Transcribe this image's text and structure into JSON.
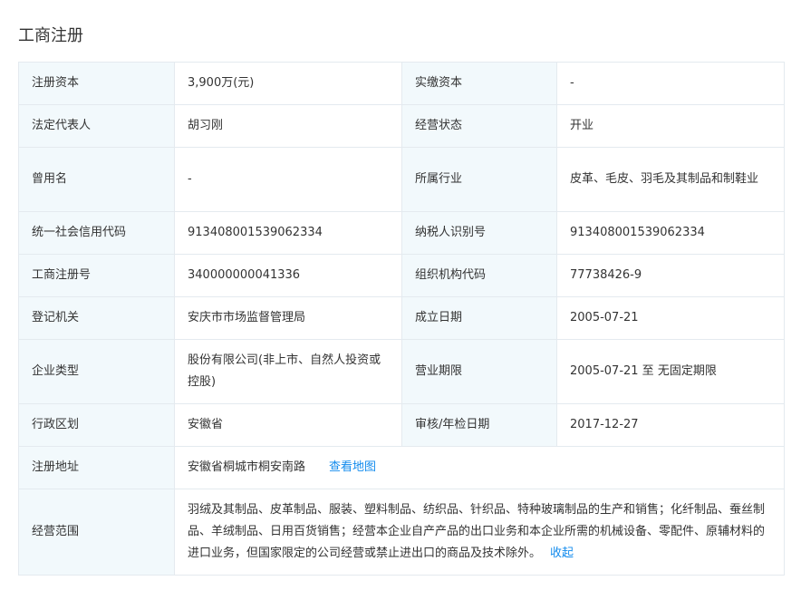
{
  "section_title": "工商注册",
  "rows": [
    [
      {
        "label": "注册资本",
        "value": "3,900万(元)"
      },
      {
        "label": "实缴资本",
        "value": "-"
      }
    ],
    [
      {
        "label": "法定代表人",
        "value": "胡习刚"
      },
      {
        "label": "经营状态",
        "value": "开业"
      }
    ],
    [
      {
        "label": "曾用名",
        "value": "-"
      },
      {
        "label": "所属行业",
        "value": "皮革、毛皮、羽毛及其制品和制鞋业"
      }
    ],
    [
      {
        "label": "统一社会信用代码",
        "value": "913408001539062334"
      },
      {
        "label": "纳税人识别号",
        "value": "913408001539062334"
      }
    ],
    [
      {
        "label": "工商注册号",
        "value": "340000000041336"
      },
      {
        "label": "组织机构代码",
        "value": "77738426-9"
      }
    ],
    [
      {
        "label": "登记机关",
        "value": "安庆市市场监督管理局"
      },
      {
        "label": "成立日期",
        "value": "2005-07-21"
      }
    ],
    [
      {
        "label": "企业类型",
        "value": "股份有限公司(非上市、自然人投资或控股)"
      },
      {
        "label": "营业期限",
        "value": "2005-07-21 至 无固定期限"
      }
    ],
    [
      {
        "label": "行政区划",
        "value": "安徽省"
      },
      {
        "label": "审核/年检日期",
        "value": "2017-12-27"
      }
    ]
  ],
  "address": {
    "label": "注册地址",
    "value": "安徽省桐城市桐安南路",
    "map_link": "查看地图"
  },
  "scope": {
    "label": "经营范围",
    "value": "羽绒及其制品、皮革制品、服装、塑料制品、纺织品、针织品、特种玻璃制品的生产和销售；化纤制品、蚕丝制品、羊绒制品、日用百货销售；经营本企业自产产品的出口业务和本企业所需的机械设备、零配件、原辅材料的进口业务，但国家限定的公司经营或禁止进出口的商品及技术除外。",
    "collapse_link": "收起"
  },
  "colors": {
    "label_bg": "#f2f9fc",
    "border": "#e4eaef",
    "link": "#128bed",
    "text": "#333333"
  }
}
